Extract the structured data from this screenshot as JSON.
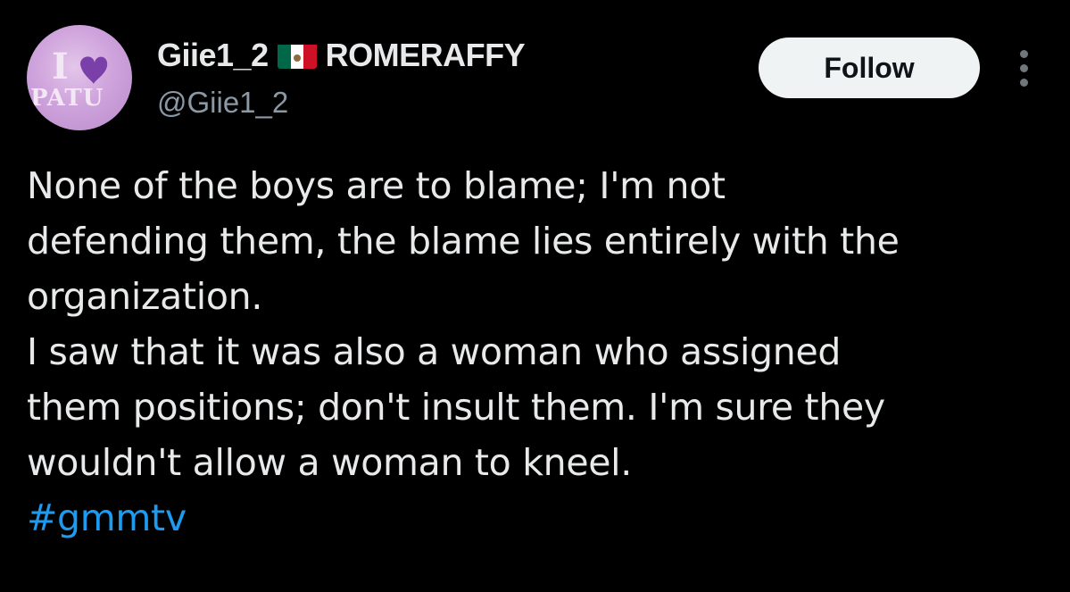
{
  "author": {
    "display_name": "Giie1_2",
    "flag": "mexico-flag",
    "display_suffix": "ROMERAFFY",
    "handle": "@Giie1_2",
    "avatar_text_top": "I",
    "avatar_text_bottom": "PATU"
  },
  "actions": {
    "follow_label": "Follow",
    "more_icon": "more-vertical-icon"
  },
  "tweet": {
    "paragraph_1": "None of the boys are to blame; I'm not\ndefending them, the blame lies entirely with the\norganization.",
    "paragraph_2": "I saw that it was also a woman who assigned\nthem positions; don't insult them. I'm sure they\nwouldn't allow a woman to kneel.",
    "hashtag": "#gmmtv"
  },
  "colors": {
    "background": "#000000",
    "text": "#e7e9ea",
    "secondary_text": "#8b98a5",
    "link": "#1d9bf0",
    "follow_button_bg": "#eff3f4",
    "avatar_bg": "#cfa3dc"
  }
}
